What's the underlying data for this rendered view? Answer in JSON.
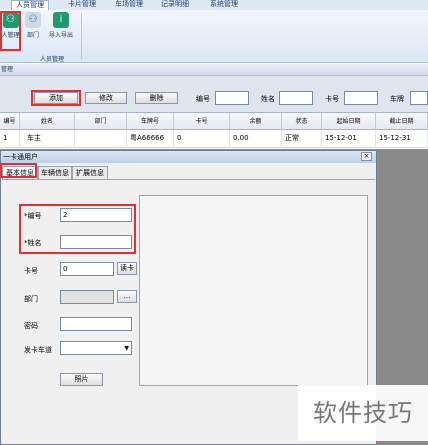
{
  "menu": {
    "tabs": [
      "人员管理",
      "卡片管理",
      "车场管理",
      "记录明细",
      "系统管理"
    ]
  },
  "ribbon": {
    "buttons": [
      {
        "label": "人管理",
        "icon": "people-icon"
      },
      {
        "label": "部门",
        "icon": "department-icon"
      },
      {
        "label": "导入导出",
        "icon": "info-icon"
      }
    ],
    "group_label": "人员管理"
  },
  "module": {
    "title": "管理"
  },
  "toolbar": {
    "add_label": "添加",
    "edit_label": "修改",
    "delete_label": "删除",
    "filters": [
      {
        "label": "编号",
        "value": ""
      },
      {
        "label": "姓名",
        "value": ""
      },
      {
        "label": "卡号",
        "value": ""
      },
      {
        "label": "车牌",
        "value": ""
      }
    ]
  },
  "table": {
    "headers": [
      "编号",
      "姓名",
      "部门",
      "车牌号",
      "卡号",
      "余额",
      "状态",
      "起始日期",
      "截止日期"
    ],
    "rows": [
      [
        "1",
        "车主",
        "",
        "粤A66666",
        "0",
        "0.00",
        "正常",
        "15-12-01",
        "15-12-31"
      ]
    ]
  },
  "dialog": {
    "title": "一卡通用户",
    "close_glyph": "×",
    "tabs": [
      "基本信息",
      "车辆信息",
      "扩展信息"
    ],
    "fields": {
      "number_label": "*编号",
      "number_value": "2",
      "name_label": "*姓名",
      "name_value": "",
      "card_label": "卡号",
      "card_value": "0",
      "read_card_button": "读卡",
      "dept_label": "部门",
      "dept_value": "",
      "browse_button": "...",
      "password_label": "密码",
      "password_value": "",
      "issuer_label": "发卡车道",
      "issuer_value": "",
      "photo_button": "照片"
    }
  },
  "watermark": "软件技巧",
  "colors": {
    "highlight": "#e03030",
    "ribbon_bg": "#dbe6f4",
    "grid_bg": "#8e8e8e"
  }
}
